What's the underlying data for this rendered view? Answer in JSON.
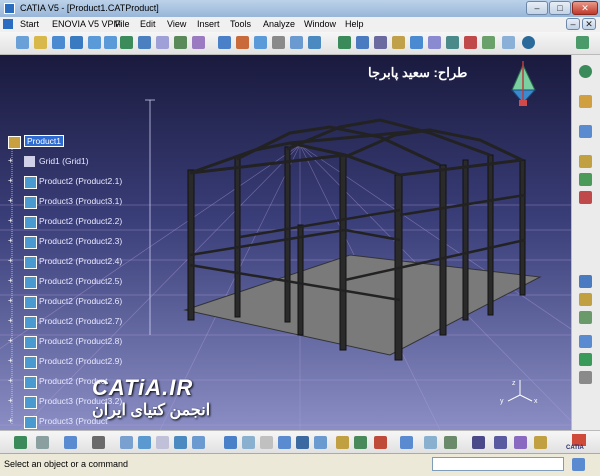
{
  "window": {
    "title": "CATIA V5 - [Product1.CATProduct]"
  },
  "menu": {
    "items": [
      "Start",
      "ENOVIA V5 VPM",
      "File",
      "Edit",
      "View",
      "Insert",
      "Tools",
      "Analyze",
      "Window",
      "Help"
    ]
  },
  "tree": {
    "root": "Product1",
    "items": [
      "Grid1 (Grid1)",
      "Product2 (Product2.1)",
      "Product3 (Product3.1)",
      "Product2 (Product2.2)",
      "Product2 (Product2.3)",
      "Product2 (Product2.4)",
      "Product2 (Product2.5)",
      "Product2 (Product2.6)",
      "Product2 (Product2.7)",
      "Product2 (Product2.8)",
      "Product2 (Product2.9)",
      "Product2 (Product",
      "Product3 (Product3.2)",
      "Product3 (Product"
    ]
  },
  "overlay": {
    "designer": "طراح: سعید پابرجا",
    "site": "CATiA.IR",
    "community": "انجمن کتیای ایران"
  },
  "compass": {
    "x": "x",
    "y": "y",
    "z": "z"
  },
  "logo": {
    "brand": "CATIA"
  },
  "status": {
    "message": "Select an object or a command",
    "command_value": ""
  }
}
